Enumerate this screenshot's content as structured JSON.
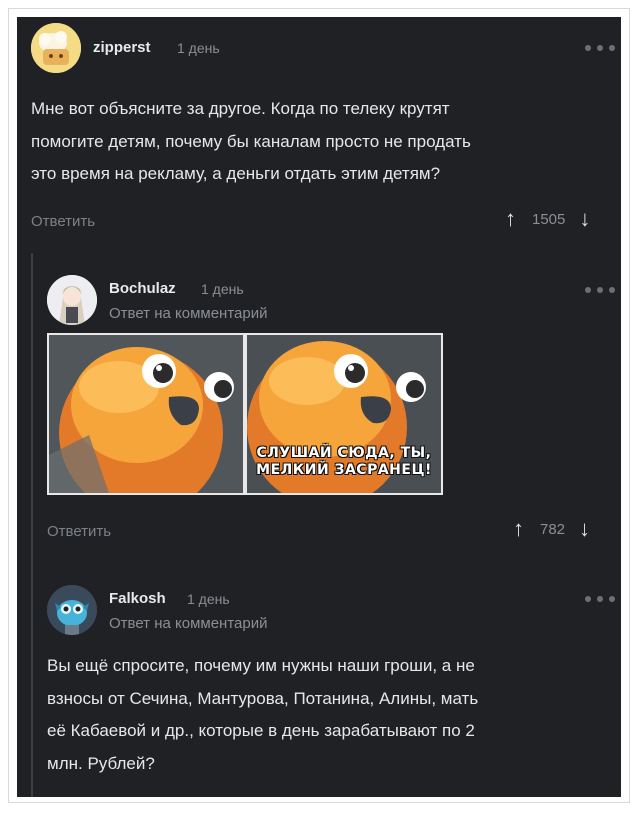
{
  "comments": [
    {
      "username": "zipperst",
      "time": "1 день",
      "text_lines": [
        "Мне вот объясните за другое. Когда по телеку крутят",
        "помогите детям, почему бы каналам просто не продать",
        "это время на рекламу, а деньги отдать этим детям?"
      ],
      "reply_label": "Ответить",
      "votes": "1505"
    },
    {
      "username": "Bochulaz",
      "time": "1 день",
      "reply_to": "Ответ на комментарий",
      "meme_caption_line1": "СЛУШАЙ СЮДА, ТЫ,",
      "meme_caption_line2": "МЕЛКИЙ ЗАСРАНЕЦ!",
      "reply_label": "Ответить",
      "votes": "782"
    },
    {
      "username": "Falkosh",
      "time": "1 день",
      "reply_to": "Ответ на комментарий",
      "text_lines": [
        "Вы ещё спросите, почему им нужны наши гроши, а не",
        "взносы от Сечина, Мантурова, Потанина, Алины, мать",
        "её Кабаевой и др., которые в день зарабатывают по 2",
        "млн. Рублей?"
      ]
    }
  ],
  "icons": {
    "upvote": "arrow-up-icon",
    "downvote": "arrow-down-icon",
    "more": "more-dots-icon"
  },
  "colors": {
    "background": "#1f2124",
    "text": "#e7e7e7",
    "muted": "#8b8f94"
  }
}
